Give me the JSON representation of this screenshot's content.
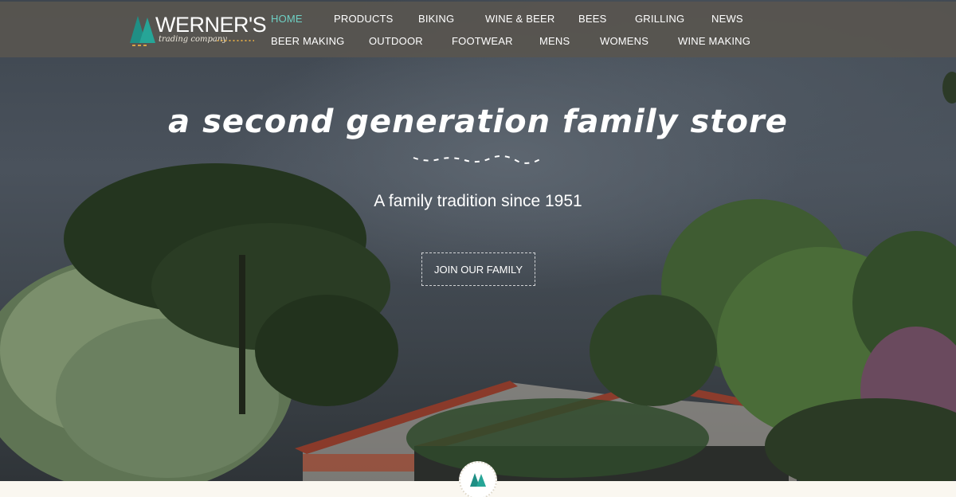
{
  "brand": {
    "name": "WERNER'S",
    "subtitle": "trading company",
    "logo_icon": "pine-trees-icon",
    "accent_color": "#1f8f85"
  },
  "nav": {
    "row1": [
      "HOME",
      "PRODUCTS",
      "BIKING",
      "WINE & BEER",
      "BEES",
      "GRILLING",
      "NEWS"
    ],
    "row2": [
      "BEER MAKING",
      "OUTDOOR",
      "FOOTWEAR",
      "MENS",
      "WOMENS",
      "WINE MAKING"
    ],
    "active": "HOME",
    "active_color": "#6ecfc3"
  },
  "hero": {
    "headline": "a second generation family store",
    "tagline": "A family tradition since 1951",
    "cta_label": "JOIN OUR FAMILY",
    "background": "tree-and-store-photo"
  },
  "badge": {
    "icon": "pine-trees-icon"
  }
}
